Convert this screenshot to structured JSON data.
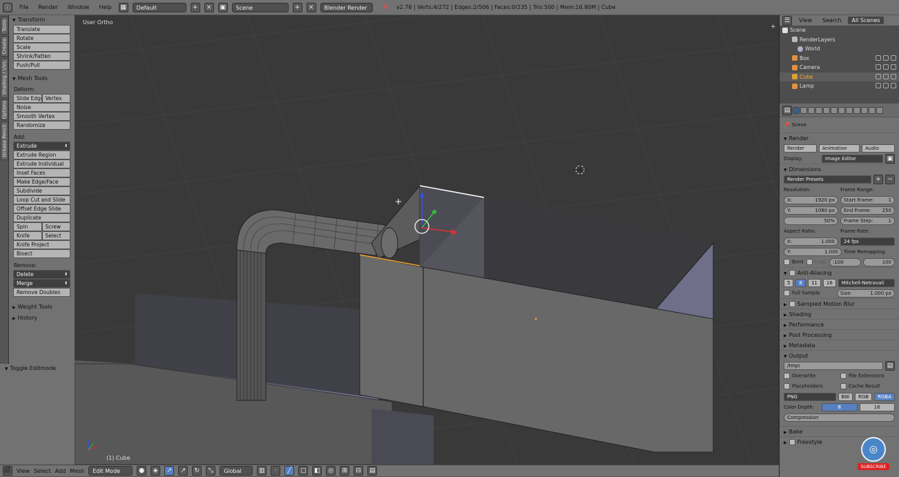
{
  "topbar": {
    "menus": [
      "File",
      "Render",
      "Window",
      "Help"
    ],
    "layout": "Default",
    "scene": "Scene",
    "engine": "Blender Render",
    "stats": "v2.76 | Verts:4/272 | Edges:2/506 | Faces:0/235 | Tris:500 | Mem:16.80M | Cube"
  },
  "left_tabs": [
    "Tools",
    "Create",
    "Shading / UVs",
    "Options",
    "Grease Pencil"
  ],
  "toolshelf": {
    "transform_title": "Transform",
    "transform": [
      "Translate",
      "Rotate",
      "Scale",
      "Shrink/Fatten",
      "Push/Pull"
    ],
    "mesh_tools_title": "Mesh Tools",
    "deform_label": "Deform:",
    "slide_edge": "Slide Edge",
    "vertex": "Vertex",
    "deform": [
      "Noise",
      "Smooth Vertex",
      "Randomize"
    ],
    "add_label": "Add:",
    "extrude": "Extrude",
    "add": [
      "Extrude Region",
      "Extrude Individual",
      "Inset Faces",
      "Make Edge/Face",
      "Subdivide",
      "Loop Cut and Slide",
      "Offset Edge Slide",
      "Duplicate"
    ],
    "spin": "Spin",
    "screw": "Screw",
    "knife": "Knife",
    "select": "Select",
    "knife_project": "Knife Project",
    "bisect": "Bisect",
    "remove_label": "Remove:",
    "delete": "Delete",
    "merge": "Merge",
    "remove_doubles": "Remove Doubles",
    "weight_tools": "Weight Tools",
    "history": "History"
  },
  "toggle_editmode": "Toggle Editmode",
  "viewport": {
    "view_label": "User Ortho",
    "object_label": "(1) Cube"
  },
  "bottombar": {
    "menus": [
      "View",
      "Select",
      "Add",
      "Mesh"
    ],
    "mode": "Edit Mode",
    "orientation": "Global"
  },
  "outliner": {
    "view": "View",
    "search": "Search",
    "all_scenes": "All Scenes",
    "items": [
      {
        "label": "Scene",
        "color": "#e0e0e0"
      },
      {
        "label": "RenderLayers",
        "color": "#bbbbbb"
      },
      {
        "label": "World",
        "color": "#aab4c8"
      },
      {
        "label": "Box",
        "color": "#e09040"
      },
      {
        "label": "Camera",
        "color": "#e09040"
      },
      {
        "label": "Cube",
        "color": "#e0a030"
      },
      {
        "label": "Lamp",
        "color": "#e09040"
      }
    ]
  },
  "properties": {
    "context": "Scene",
    "render_title": "Render",
    "render_btn": "Render",
    "animation_btn": "Animation",
    "audio_btn": "Audio",
    "display_label": "Display:",
    "display_value": "Image Editor",
    "dimensions_title": "Dimensions",
    "render_presets": "Render Presets",
    "resolution_label": "Resolution:",
    "frame_range_label": "Frame Range:",
    "res_x_label": "X:",
    "res_x": "1920 px",
    "res_y_label": "Y:",
    "res_y": "1080 px",
    "res_pct": "50%",
    "start_label": "Start Frame:",
    "start": "1",
    "end_label": "End Frame:",
    "end": "250",
    "step_label": "Frame Step:",
    "step": "1",
    "aspect_label": "Aspect Ratio:",
    "frame_rate_label": "Frame Rate:",
    "asp_x": "1.000",
    "asp_y": "1.000",
    "fps": "24 fps",
    "time_remap_label": "Time Remapping:",
    "remap_old": ":100",
    "remap_new": "100",
    "bord": "Bord",
    "crop": "Crop",
    "aa_title": "Anti-Aliasing",
    "aa_samples": [
      "5",
      "8",
      "11",
      "16"
    ],
    "aa_filter": "Mitchell-Netravali",
    "full_sample": "Full Sample",
    "size_label": "Size:",
    "size_value": "1.000 px",
    "sampled_motion_blur": "Sampled Motion Blur",
    "shading": "Shading",
    "performance": "Performance",
    "post_processing": "Post Processing",
    "metadata": "Metadata",
    "output_title": "Output",
    "output_path": "/tmp\\",
    "overwrite": "Overwrite",
    "file_extensions": "File Extensions",
    "placeholders": "Placeholders",
    "cache_result": "Cache Result",
    "format": "PNG",
    "bw": "BW",
    "rgb": "RGB",
    "rgba": "RGBA",
    "color_depth_label": "Color Depth:",
    "color_depth_8": "8",
    "color_depth_16": "16",
    "compression": "Compression",
    "bake": "Bake",
    "freestyle": "Freestyle"
  },
  "subscribe": "SUBSCRIBE"
}
